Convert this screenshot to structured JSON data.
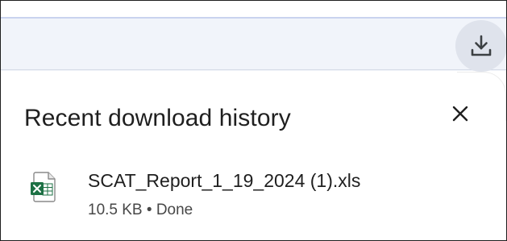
{
  "toolbar": {
    "download_button_icon": "download-icon"
  },
  "panel": {
    "title": "Recent download history",
    "close_icon": "close-icon",
    "items": [
      {
        "file_name": "SCAT_Report_1_19_2024 (1).xls",
        "meta": "10.5 KB • Done",
        "icon": "excel-file-icon"
      }
    ]
  },
  "colors": {
    "toolbar_bg": "#f1f4fa",
    "download_button_bg": "#dfe3ec",
    "text_primary": "#1f1f1f",
    "text_secondary": "#474747",
    "excel_green": "#1e7145"
  }
}
